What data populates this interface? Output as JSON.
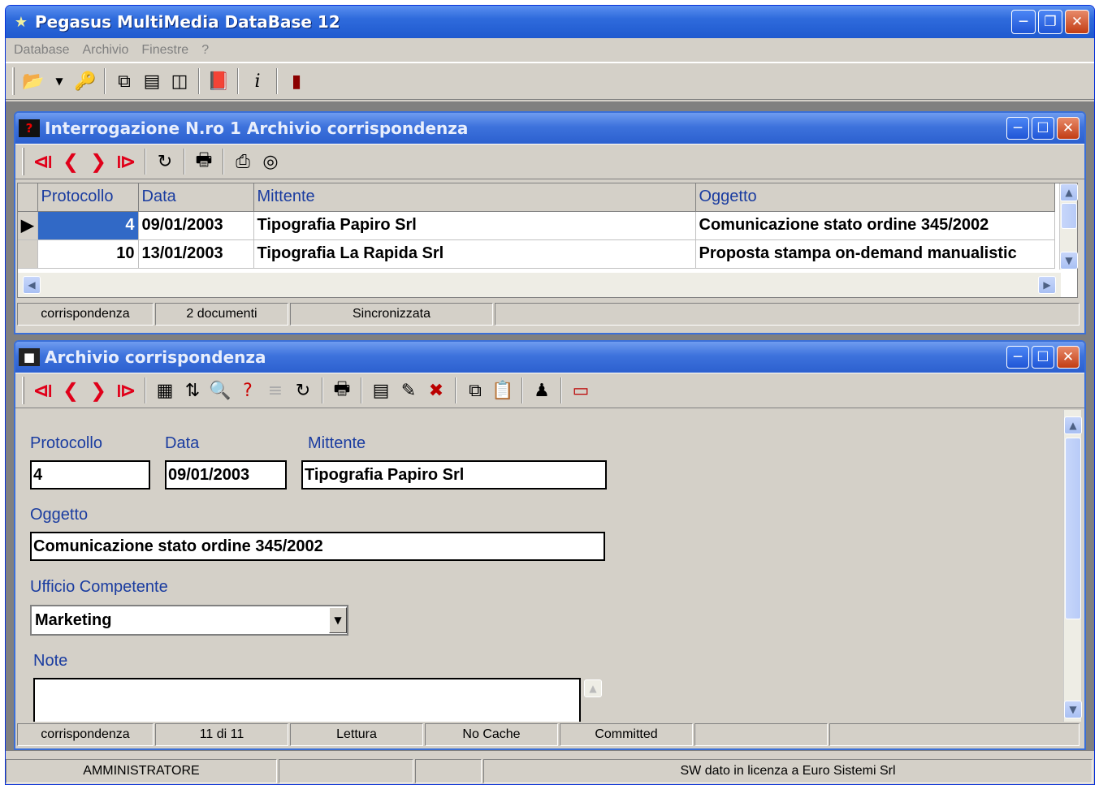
{
  "app": {
    "title": "Pegasus MultiMedia DataBase 12"
  },
  "menu": [
    "Database",
    "Archivio",
    "Finestre",
    "?"
  ],
  "query_window": {
    "title": "Interrogazione N.ro 1   Archivio corrispondenza",
    "columns": [
      "Protocollo",
      "Data",
      "Mittente",
      "Oggetto"
    ],
    "rows": [
      {
        "protocollo": "4",
        "data": "09/01/2003",
        "mittente": "Tipografia Papiro Srl",
        "oggetto": "Comunicazione stato ordine 345/2002"
      },
      {
        "protocollo": "10",
        "data": "13/01/2003",
        "mittente": "Tipografia La Rapida Srl",
        "oggetto": "Proposta stampa on-demand manualistic"
      }
    ],
    "status": [
      "corrispondenza",
      "2 documenti",
      "Sincronizzata"
    ]
  },
  "record_window": {
    "title": "Archivio corrispondenza",
    "fields": {
      "protocollo_label": "Protocollo",
      "protocollo_value": "4",
      "data_label": "Data",
      "data_value": "09/01/2003",
      "mittente_label": "Mittente",
      "mittente_value": "Tipografia Papiro Srl",
      "oggetto_label": "Oggetto",
      "oggetto_value": "Comunicazione stato ordine 345/2002",
      "ufficio_label": "Ufficio Competente",
      "ufficio_value": "Marketing",
      "note_label": "Note",
      "note_value": ""
    },
    "status": [
      "corrispondenza",
      "11 di 11",
      "Lettura",
      "No Cache",
      "Committed"
    ]
  },
  "main_status": {
    "user": "AMMINISTRATORE",
    "license": "SW dato in licenza a Euro Sistemi Srl"
  }
}
